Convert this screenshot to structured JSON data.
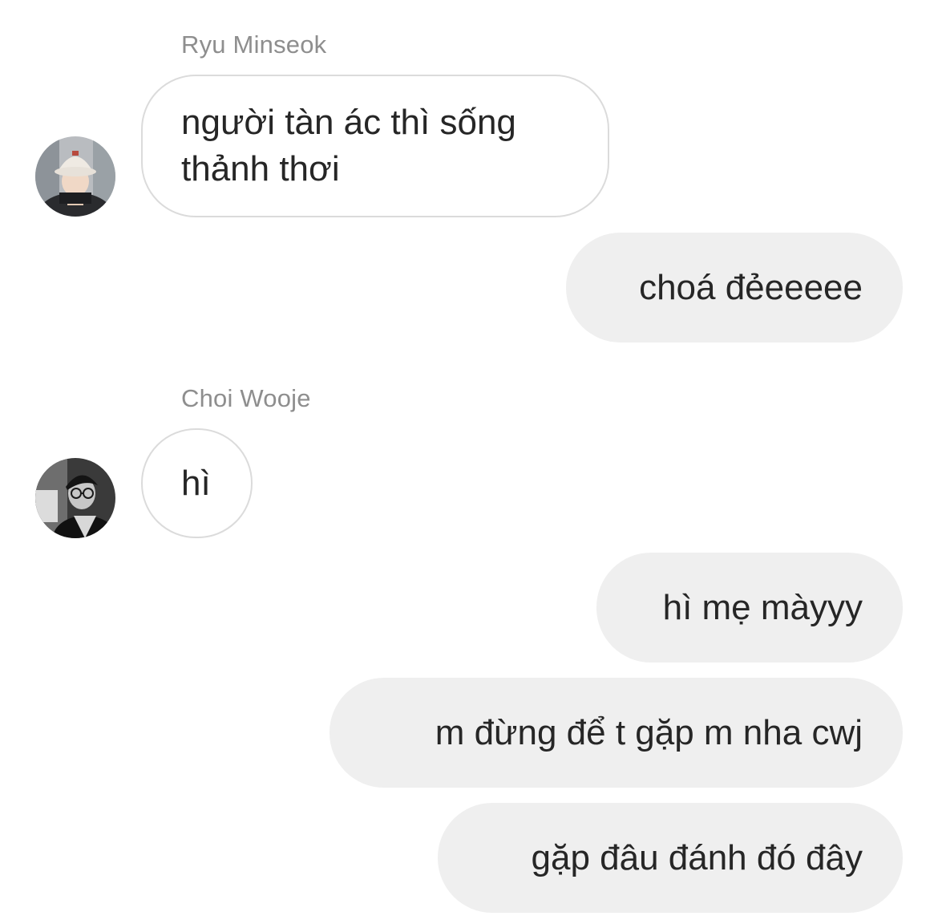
{
  "conversation": {
    "groups": [
      {
        "sender": "Ryu Minseok",
        "avatar_icon": "user-avatar-photo-hat",
        "messages": [
          "người tàn ác thì sống thảnh thơi"
        ]
      },
      {
        "sender": "me",
        "messages": [
          "choá đẻeeeee"
        ]
      },
      {
        "sender": "Choi Wooje",
        "avatar_icon": "user-avatar-photo-glasses",
        "messages": [
          "hì"
        ]
      },
      {
        "sender": "me",
        "messages": [
          "hì mẹ màyyy",
          "m đừng để t gặp m nha cwj",
          "gặp đâu đánh đó đây"
        ]
      }
    ]
  },
  "colors": {
    "incoming_border": "#dbdbdb",
    "outgoing_bg": "#efefef",
    "sender_name": "#8e8e8e",
    "text": "#262626"
  }
}
